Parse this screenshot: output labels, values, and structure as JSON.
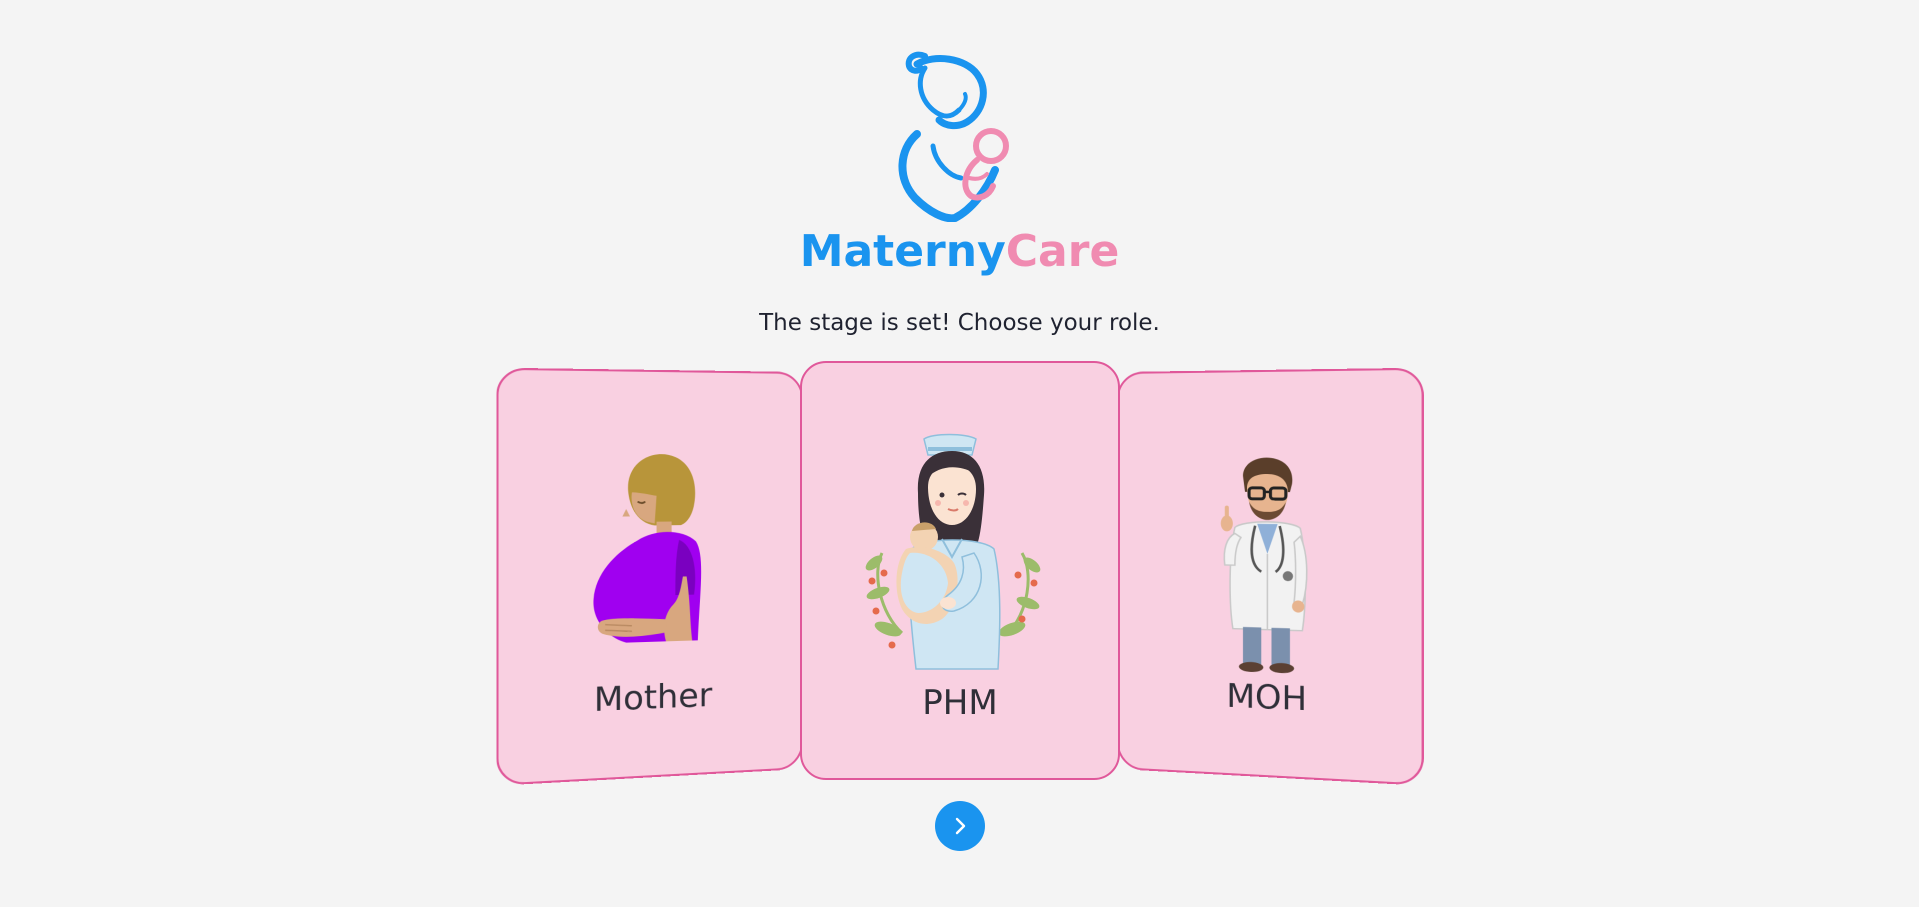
{
  "brand": {
    "part1": "Materny",
    "part2": "Care",
    "logo_icon": "mother-baby-logo-icon"
  },
  "tagline": "The stage is set! Choose your role.",
  "roles": [
    {
      "label": "Mother",
      "icon": "pregnant-woman-icon"
    },
    {
      "label": "PHM",
      "icon": "nurse-with-baby-icon"
    },
    {
      "label": "MOH",
      "icon": "doctor-icon"
    }
  ],
  "next_button": {
    "icon": "chevron-right-icon"
  },
  "colors": {
    "brand_blue": "#1a94ef",
    "brand_pink": "#f08bb1",
    "card_bg": "#f9d0e1",
    "card_border": "#e0589a",
    "page_bg": "#f4f4f4"
  }
}
